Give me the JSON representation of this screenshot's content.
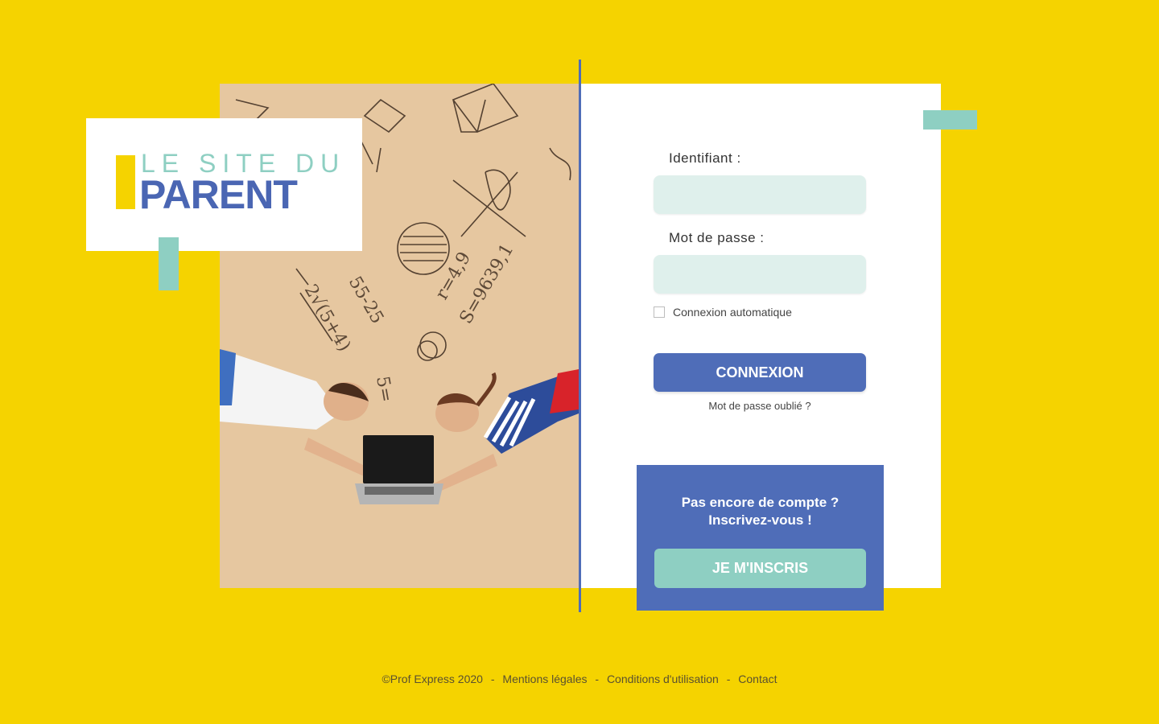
{
  "logo": {
    "line1": "LE SITE DU",
    "line2": "PARENT"
  },
  "photo": {
    "alt": "Deux enfants allongés devant un ordinateur portable, formules mathématiques dessinées"
  },
  "login": {
    "identifiant_label": "Identifiant :",
    "identifiant_value": "",
    "password_label": "Mot de passe :",
    "password_value": "",
    "remember_label": "Connexion automatique",
    "remember_checked": false,
    "submit_label": "CONNEXION",
    "forgot_label": "Mot de passe oublié ?"
  },
  "register": {
    "line1": "Pas encore de compte ?",
    "line2": "Inscrivez-vous !",
    "button_label": "JE M'INSCRIS"
  },
  "footer": {
    "copyright": "©Prof Express 2020",
    "links": [
      "Mentions légales",
      "Conditions d'utilisation",
      "Contact"
    ],
    "separator": "-"
  },
  "colors": {
    "background": "#f5d300",
    "primary_blue": "#4f6db8",
    "teal": "#8ecfc2",
    "input_bg": "#dff0ec"
  }
}
